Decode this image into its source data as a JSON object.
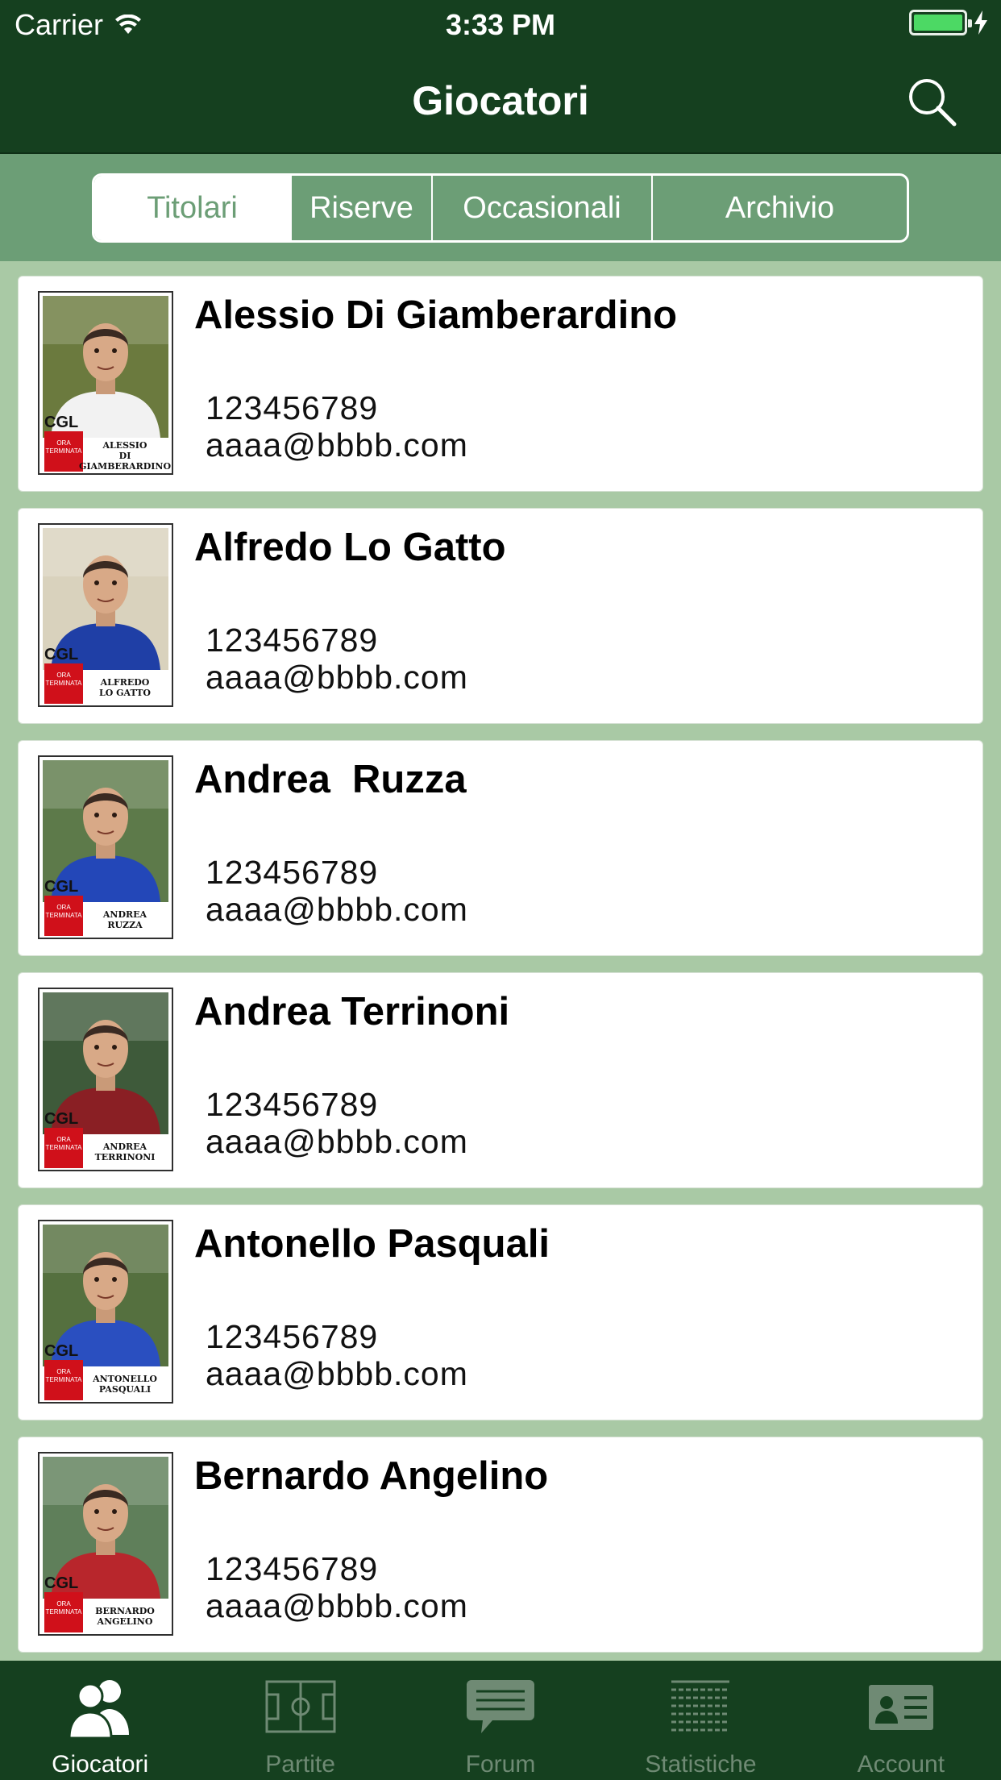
{
  "status_bar": {
    "carrier": "Carrier",
    "time": "3:33 PM",
    "battery_level": 1.0
  },
  "nav": {
    "title": "Giocatori",
    "search_icon": "search-icon"
  },
  "segments": [
    {
      "label": "Titolari",
      "active": true
    },
    {
      "label": "Riserve",
      "active": false
    },
    {
      "label": "Occasionali",
      "active": false
    },
    {
      "label": "Archivio",
      "active": false
    }
  ],
  "players": [
    {
      "name": "Alessio Di Giamberardino",
      "phone": "123456789",
      "email": "aaaa@bbbb.com",
      "caption": "ALESSIO\nDI GIAMBERARDINO",
      "jersey": "#f2f2f2",
      "bg": "#6b7a3e"
    },
    {
      "name": "Alfredo Lo Gatto",
      "phone": "123456789",
      "email": "aaaa@bbbb.com",
      "caption": "ALFREDO\nLO GATTO",
      "jersey": "#1f3fa6",
      "bg": "#d9d2bd"
    },
    {
      "name": "Andrea  Ruzza",
      "phone": "123456789",
      "email": "aaaa@bbbb.com",
      "caption": "ANDREA\nRUZZA",
      "jersey": "#2347b8",
      "bg": "#5d7a4a"
    },
    {
      "name": "Andrea Terrinoni",
      "phone": "123456789",
      "email": "aaaa@bbbb.com",
      "caption": "ANDREA\nTERRINONI",
      "jersey": "#8a1f24",
      "bg": "#3e5a3a"
    },
    {
      "name": "Antonello Pasquali",
      "phone": "123456789",
      "email": "aaaa@bbbb.com",
      "caption": "ANTONELLO\nPASQUALI",
      "jersey": "#2a4fc0",
      "bg": "#55703f"
    },
    {
      "name": "Bernardo Angelino",
      "phone": "123456789",
      "email": "aaaa@bbbb.com",
      "caption": "BERNARDO\nANGELINO",
      "jersey": "#b8262c",
      "bg": "#5f7f5a"
    }
  ],
  "badge": {
    "logo_text": "CGL",
    "badge_text": "ORA TERMINATA"
  },
  "tabs": [
    {
      "label": "Giocatori",
      "icon": "people-icon",
      "active": true
    },
    {
      "label": "Partite",
      "icon": "field-icon",
      "active": false
    },
    {
      "label": "Forum",
      "icon": "chat-bubble-icon",
      "active": false
    },
    {
      "label": "Statistiche",
      "icon": "stats-list-icon",
      "active": false
    },
    {
      "label": "Account",
      "icon": "id-card-icon",
      "active": false
    }
  ],
  "colors": {
    "nav_bg": "#15401f",
    "segment_bg": "#6c9e76",
    "list_bg": "#a9c9a5",
    "tab_inactive": "#6f8a74",
    "tab_active": "#ffffff"
  }
}
